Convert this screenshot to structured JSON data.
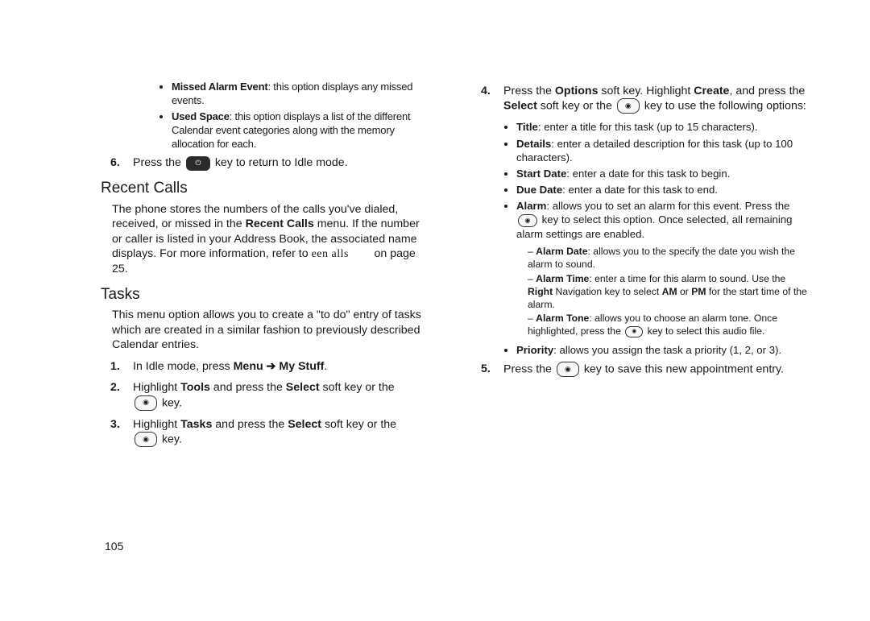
{
  "page_number": "105",
  "left": {
    "bullets_top": [
      {
        "title": "Missed Alarm Event",
        "text": ": this option displays any missed events."
      },
      {
        "title": "Used Space",
        "text": ": this option displays a list of the different Calendar event categories along with the memory allocation for each."
      }
    ],
    "step6_pre": "Press the ",
    "step6_post": " key to return to Idle mode.",
    "h_recent": "Recent Calls",
    "recent_p1": "The phone stores the numbers of the calls you've dialed, received, or missed in the ",
    "recent_bold": "Recent Calls",
    "recent_p2": " menu. If the number or caller is listed in your Address Book, the associated name displays. For more information, refer to ",
    "recent_ref": "een alls",
    "recent_p3": " on page 25.",
    "h_tasks": "Tasks",
    "tasks_p": "This menu option allows you to create a \"to do\" entry of tasks which are created in a similar fashion to previously described Calendar entries.",
    "step1_pre": "In Idle mode, press ",
    "step1_bold": "Menu ➔ My Stuff",
    "step1_post": ".",
    "step2_pre": "Highlight ",
    "step2_b1": "Tools",
    "step2_mid": " and press the ",
    "step2_b2": "Select",
    "step2_post": " soft key or the ",
    "step2_tail": " key.",
    "step3_pre": "Highlight ",
    "step3_b1": "Tasks",
    "step3_mid": " and press the ",
    "step3_b2": "Select",
    "step3_post": " soft key or the ",
    "step3_tail": " key."
  },
  "right": {
    "step4_a": "Press the ",
    "step4_b1": "Options",
    "step4_b": " soft key. Highlight ",
    "step4_b2": "Create",
    "step4_c": ", and press the ",
    "step4_b3": "Select",
    "step4_d": " soft key or the ",
    "step4_e": " key to use the following options:",
    "opts": [
      {
        "title": "Title",
        "text": ": enter a title for this task (up to 15 characters)."
      },
      {
        "title": "Details",
        "text": ": enter a detailed description for this task (up to 100 characters)."
      },
      {
        "title": "Start Date",
        "text": ": enter a date for this task to begin."
      },
      {
        "title": "Due Date",
        "text": ": enter a date for this task to end."
      }
    ],
    "alarm_title": "Alarm",
    "alarm_text_a": ": allows you to set an alarm for this event. Press the ",
    "alarm_text_b": " key to select this option. Once selected, all remaining alarm settings are enabled.",
    "dashes": [
      {
        "title": "Alarm Date",
        "text": ": allows you to the specify the date you wish the alarm to sound."
      },
      {
        "title": "Alarm Time",
        "text_a": ": enter a time for this alarm to sound. Use the ",
        "b1": "Right",
        "text_b": " Navigation key to select ",
        "b2": "AM",
        "text_c": " or ",
        "b3": "PM",
        "text_d": " for the start time of the alarm."
      },
      {
        "title": "Alarm Tone",
        "text_a": ": allows you to choose an alarm tone. Once highlighted, press the ",
        "text_b": " key to select this audio file."
      }
    ],
    "priority_title": "Priority",
    "priority_text": ": allows you assign the task a priority (1, 2, or 3).",
    "step5_pre": "Press the ",
    "step5_post": " key to save this new appointment entry."
  }
}
